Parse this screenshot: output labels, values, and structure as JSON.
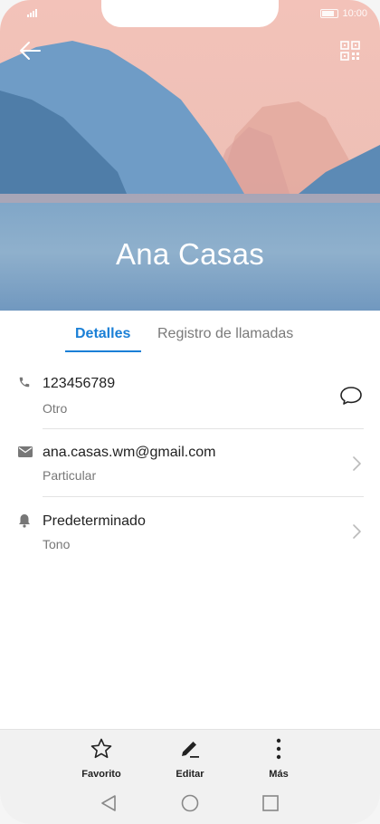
{
  "status_bar": {
    "time": "10:00"
  },
  "contact": {
    "name": "Ana Casas"
  },
  "tabs": [
    {
      "label": "Detalles",
      "active": true
    },
    {
      "label": "Registro de llamadas",
      "active": false
    }
  ],
  "details": [
    {
      "icon": "phone-icon",
      "title": "123456789",
      "subtitle": "Otro",
      "action_icon": "message-icon"
    },
    {
      "icon": "mail-icon",
      "title": "ana.casas.wm@gmail.com",
      "subtitle": "Particular",
      "action_icon": "chevron-right-icon"
    },
    {
      "icon": "bell-icon",
      "title": "Predeterminado",
      "subtitle": "Tono",
      "action_icon": "chevron-right-icon"
    }
  ],
  "bottom_actions": [
    {
      "icon": "star-icon",
      "label": "Favorito"
    },
    {
      "icon": "edit-icon",
      "label": "Editar"
    },
    {
      "icon": "more-vertical-icon",
      "label": "Más"
    }
  ],
  "colors": {
    "accent": "#1a7fd6"
  }
}
